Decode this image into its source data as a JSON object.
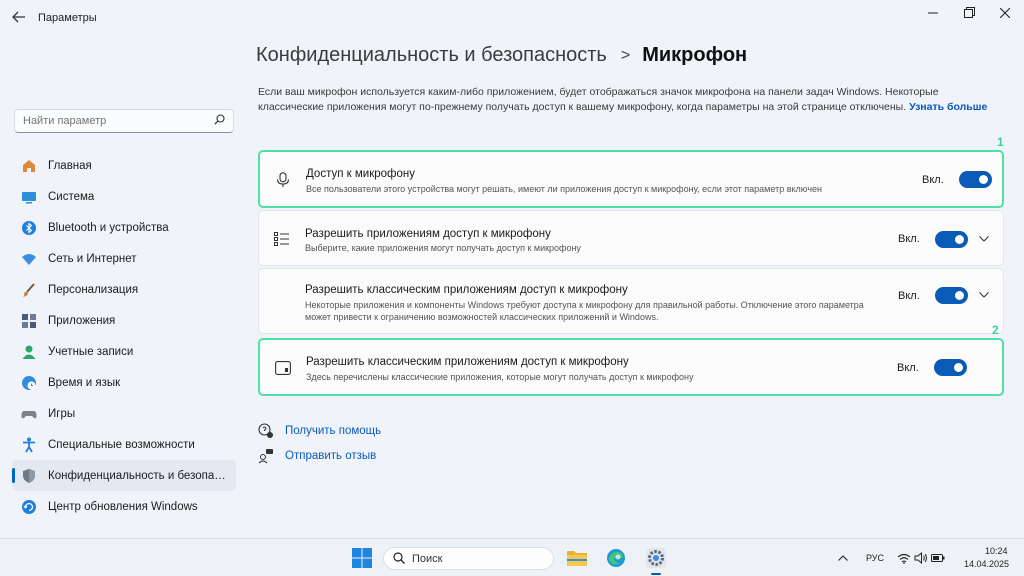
{
  "window": {
    "app_title": "Параметры",
    "back_icon": "arrow-left-icon",
    "controls": [
      "minimize-icon",
      "maximize-icon",
      "close-icon"
    ]
  },
  "sidebar": {
    "search_placeholder": "Найти параметр",
    "items": [
      {
        "label": "Главная",
        "icon": "home-icon",
        "color": "#e0873a"
      },
      {
        "label": "Система",
        "icon": "monitor-icon",
        "color": "#2d8fdb"
      },
      {
        "label": "Bluetooth и устройства",
        "icon": "bluetooth-icon",
        "color": "#1f7fe0"
      },
      {
        "label": "Сеть и Интернет",
        "icon": "wifi-icon",
        "color": "#3a8de0"
      },
      {
        "label": "Персонализация",
        "icon": "brush-icon",
        "color": "#c9822f"
      },
      {
        "label": "Приложения",
        "icon": "apps-icon",
        "color": "#4a5c78"
      },
      {
        "label": "Учетные записи",
        "icon": "person-icon",
        "color": "#2ca66a"
      },
      {
        "label": "Время и язык",
        "icon": "globe-clock-icon",
        "color": "#2d8fdb"
      },
      {
        "label": "Игры",
        "icon": "gamepad-icon",
        "color": "#7a828e"
      },
      {
        "label": "Специальные возможности",
        "icon": "accessibility-icon",
        "color": "#1f7fe0"
      },
      {
        "label": "Конфиденциальность и безопасн.",
        "icon": "shield-icon",
        "color": "#6f7a88",
        "active": true
      },
      {
        "label": "Центр обновления Windows",
        "icon": "update-icon",
        "color": "#1f7fe0"
      }
    ]
  },
  "main": {
    "breadcrumb_parent": "Конфиденциальность и безопасность",
    "breadcrumb_sep": ">",
    "breadcrumb_current": "Микрофон",
    "description": "Если ваш микрофон используется каким-либо приложением, будет отображаться значок микрофона на панели задач Windows. Некоторые классические приложения могут по-прежнему получать доступ к вашему микрофону, когда параметры на этой странице отключены.",
    "learn_more": "Узнать больше",
    "cards": [
      {
        "title": "Доступ к микрофону",
        "subtitle": "Все пользователи этого устройства могут решать, имеют ли приложения доступ к микрофону, если этот параметр включен",
        "state": "Вкл.",
        "on": true,
        "icon": "microphone-icon",
        "badge": "1"
      },
      {
        "title": "Разрешить приложениям доступ к микрофону",
        "subtitle": "Выберите, какие приложения могут получать доступ к микрофону",
        "state": "Вкл.",
        "on": true,
        "icon": "list-icon"
      },
      {
        "title": "Разрешить классическим приложениям доступ к микрофону",
        "subtitle": "Некоторые приложения и компоненты Windows требуют доступа к микрофону для правильной работы. Отключение этого параметра может привести к ограничению возможностей классических приложений и Windows.",
        "state": "Вкл.",
        "on": true
      },
      {
        "title": "Разрешить классическим приложениям доступ к микрофону",
        "subtitle": "Здесь перечислены классические приложения, которые могут получать доступ к микрофону",
        "state": "Вкл.",
        "on": true,
        "icon": "window-app-icon",
        "badge": "2"
      }
    ],
    "links": [
      {
        "label": "Получить помощь",
        "icon": "help-icon"
      },
      {
        "label": "Отправить отзыв",
        "icon": "feedback-icon"
      }
    ]
  },
  "taskbar": {
    "search_placeholder": "Поиск",
    "language": "РУС",
    "time": "10:24",
    "date": "14.04.2025",
    "apps": [
      "windows-start-icon",
      "file-explorer-icon",
      "edge-icon",
      "settings-icon"
    ],
    "accent": "#0a5bb5"
  }
}
